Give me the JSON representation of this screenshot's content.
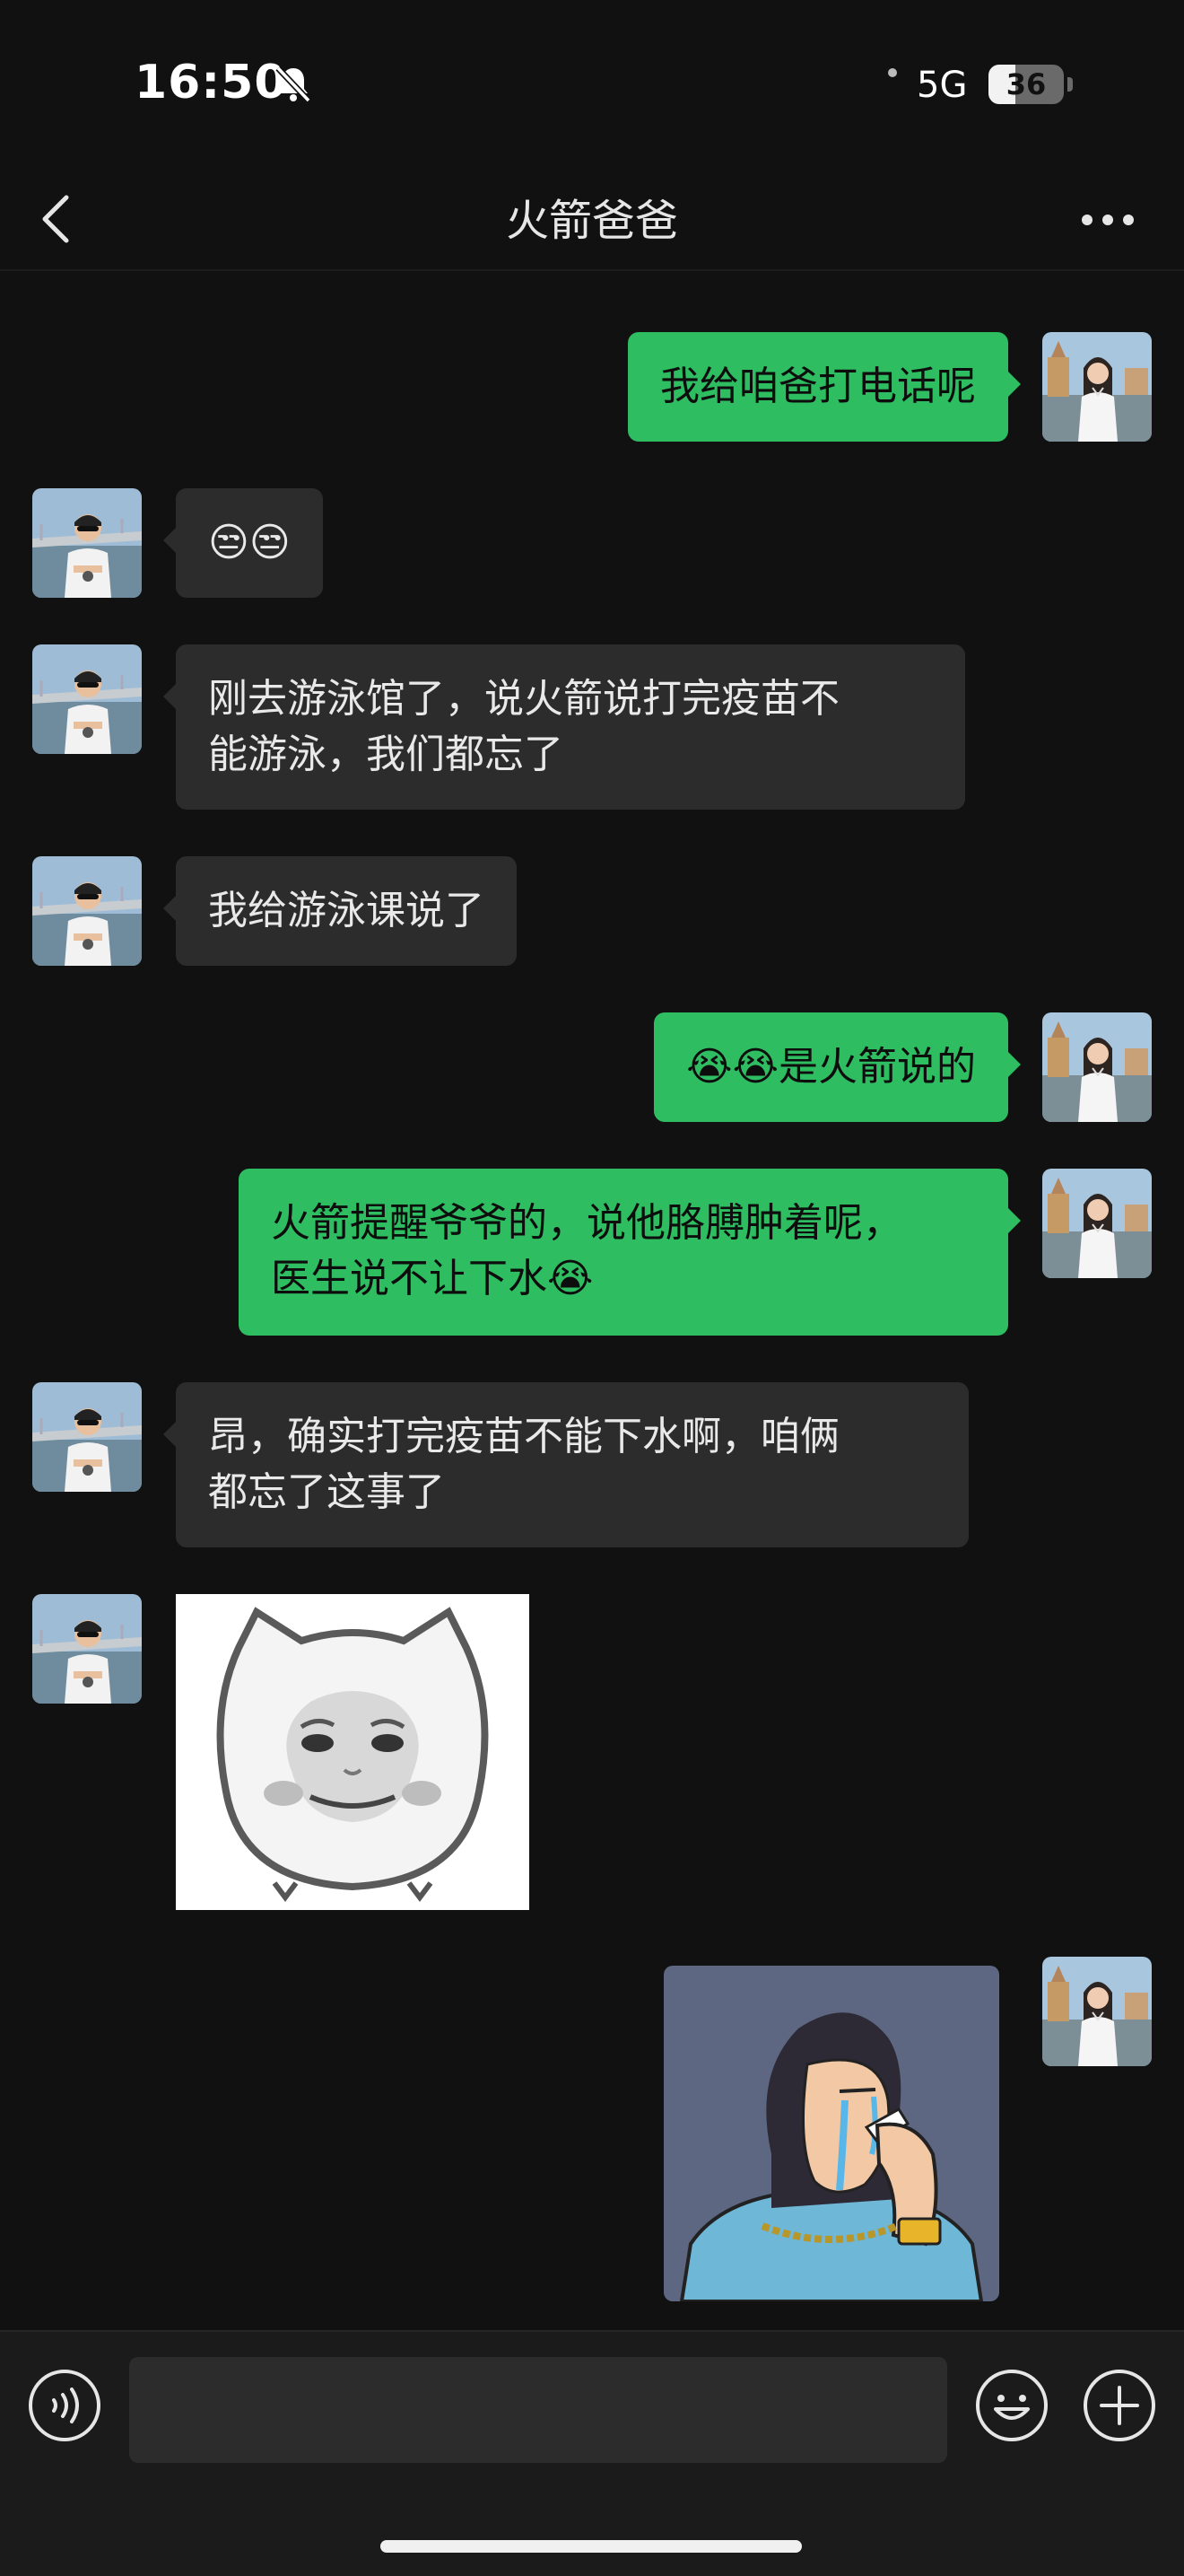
{
  "status_bar": {
    "time": "16:50",
    "network": "5G",
    "battery": "36",
    "battery_level": 0.36,
    "icons": [
      "bell-slash-icon",
      "battery-icon"
    ]
  },
  "nav": {
    "title": "火箭爸爸",
    "icons": [
      "back-chevron-icon",
      "more-dots-icon"
    ]
  },
  "messages": [
    {
      "sender": "me",
      "text": "我给咱爸打电话呢"
    },
    {
      "sender": "other",
      "text": "😒😒"
    },
    {
      "sender": "other",
      "text": "刚去游泳馆了，说火箭说打完疫苗不\n能游泳，我们都忘了"
    },
    {
      "sender": "other",
      "text": "我给游泳课说了"
    },
    {
      "sender": "me",
      "text": "😭😭是火箭说的"
    },
    {
      "sender": "me",
      "text": "火箭提醒爷爷的，说他胳膊肿着呢，\n医生说不让下水😭"
    },
    {
      "sender": "other",
      "text": "昂，确实打完疫苗不能下水啊，咱俩\n都忘了这事了"
    },
    {
      "sender": "other",
      "sticker": "cat-face-sticker"
    },
    {
      "sender": "me",
      "sticker": "crying-woman-sticker"
    }
  ],
  "input_bar": {
    "placeholder": "",
    "icons": [
      "voice-icon",
      "emoji-icon",
      "plus-icon"
    ]
  },
  "colors": {
    "background": "#111111",
    "outgoing_bubble": "#2ebd61",
    "incoming_bubble": "#2c2c2c"
  }
}
